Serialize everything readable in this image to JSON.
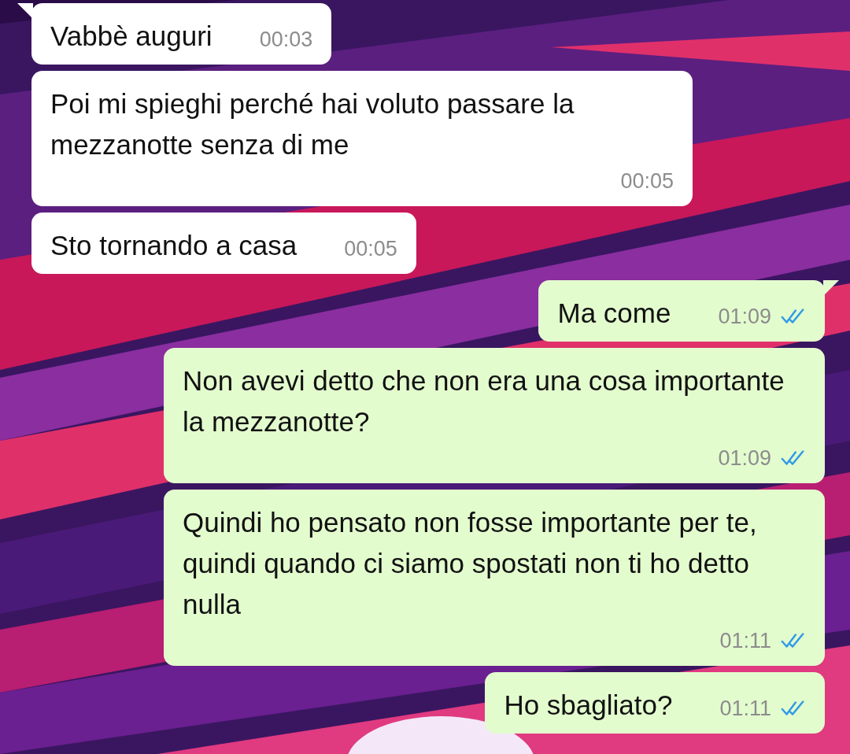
{
  "messages": [
    {
      "kind": "incoming",
      "text": "Vabbè auguri",
      "time": "00:03",
      "tail": true
    },
    {
      "kind": "incoming",
      "text": "Poi mi spieghi perché hai voluto passare la mezzanotte senza di me",
      "time": "00:05",
      "tail": false
    },
    {
      "kind": "incoming",
      "text": "Sto tornando a casa",
      "time": "00:05",
      "tail": false
    },
    {
      "kind": "outgoing",
      "text": "Ma come",
      "time": "01:09",
      "tail": true,
      "read": true
    },
    {
      "kind": "outgoing",
      "text": "Non avevi detto che non era una cosa importante la mezzanotte?",
      "time": "01:09",
      "tail": false,
      "read": true
    },
    {
      "kind": "outgoing",
      "text": "Quindi ho pensato non fosse importante per te, quindi quando ci siamo spostati non ti ho detto nulla",
      "time": "01:11",
      "tail": false,
      "read": true
    },
    {
      "kind": "outgoing",
      "text": "Ho sbagliato?",
      "time": "01:11",
      "tail": false,
      "read": true
    }
  ]
}
